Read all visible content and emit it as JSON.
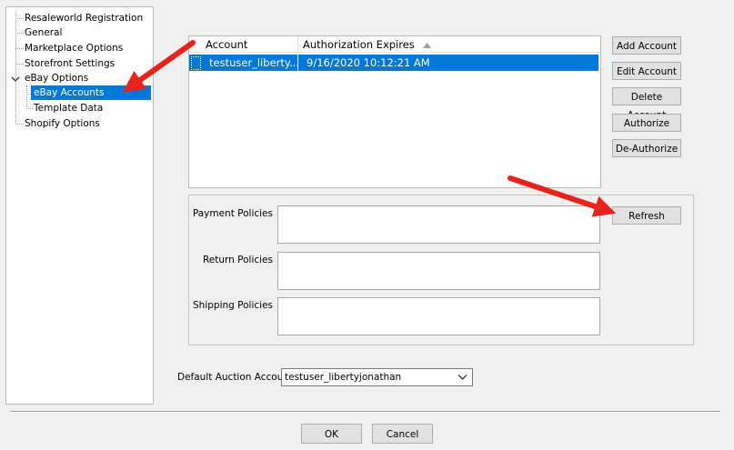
{
  "tree": {
    "items": [
      {
        "label": "Resaleworld Registration"
      },
      {
        "label": "General"
      },
      {
        "label": "Marketplace Options"
      },
      {
        "label": "Storefront Settings"
      },
      {
        "label": "eBay Options"
      },
      {
        "label": "eBay Accounts"
      },
      {
        "label": "Template Data"
      },
      {
        "label": "Shopify Options"
      }
    ]
  },
  "accounts_table": {
    "columns": [
      "Account",
      "Authorization Expires"
    ],
    "sorted_column": "Authorization Expires",
    "rows": [
      {
        "account": "testuser_liberty...",
        "expires": "9/16/2020 10:12:21 AM",
        "selected": true
      }
    ]
  },
  "buttons": {
    "add_account": "Add Account",
    "edit_account": "Edit Account",
    "delete_account": "Delete Account",
    "authorize": "Authorize",
    "de_authorize": "De-Authorize",
    "refresh": "Refresh",
    "ok": "OK",
    "cancel": "Cancel"
  },
  "policies": {
    "payment_label": "Payment Policies",
    "return_label": "Return Policies",
    "shipping_label": "Shipping Policies"
  },
  "default_auction": {
    "label": "Default Auction Account",
    "value": "testuser_libertyjonathan"
  },
  "colors": {
    "selection": "#0078d7",
    "annotation_arrow": "#e8231c"
  }
}
